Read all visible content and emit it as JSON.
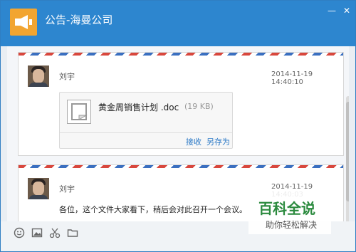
{
  "window": {
    "title": "公告-海曼公司"
  },
  "messages": [
    {
      "sender": "刘宇",
      "time": "2014-11-19 14:40:10",
      "attachment": {
        "name": "黄金周销售计划 .doc",
        "size": "(19 KB)",
        "actions": {
          "receive": "接收",
          "save_as": "另存为"
        }
      }
    },
    {
      "sender": "刘宇",
      "time": "2014-11-19 14:40:03",
      "text": "各位，这个文件大家看下，稍后会对此召开一个会议。"
    }
  ],
  "toolbar": {
    "icons": [
      "emoji-icon",
      "image-icon",
      "scissors-icon",
      "folder-icon"
    ]
  },
  "watermark": {
    "title": "百科全说",
    "subtitle": "助你轻松解决"
  },
  "colors": {
    "titlebar": "#2d86cf",
    "logo": "#f2a531",
    "link": "#2a78c6"
  }
}
